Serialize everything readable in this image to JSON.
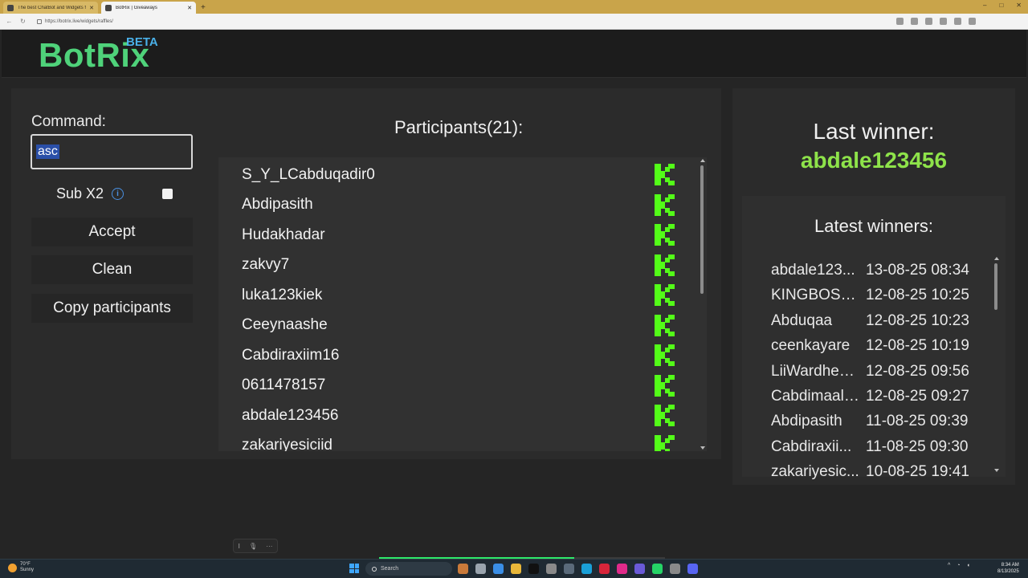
{
  "browser": {
    "tabs": [
      {
        "title": "The best ChatBot and Widgets fo",
        "active": false
      },
      {
        "title": "BotRix | Giveaways",
        "active": true
      }
    ],
    "url": "https://botrix.live/widgets/raffles/"
  },
  "app": {
    "logo": "BotRix",
    "badge": "BETA",
    "accent": "#4fd27a",
    "badge_color": "#4ab0e8"
  },
  "controls": {
    "command_label": "Command:",
    "command_value": "asc",
    "sub_label": "Sub X2",
    "sub_checked": false,
    "accept_label": "Accept",
    "clean_label": "Clean",
    "copy_label": "Copy participants"
  },
  "participants": {
    "title": "Participants(21):",
    "items": [
      "S_Y_LCabduqadir0",
      "Abdipasith",
      "Hudakhadar",
      "zakvy7",
      "luka123kiek",
      "Ceeynaashe",
      "Cabdiraxiim16",
      "0611478157",
      "abdale123456",
      "zakariyesiciid"
    ],
    "platform_icon": "kick-icon",
    "platform_color": "#53fc18"
  },
  "winner": {
    "last_label": "Last winner:",
    "last_name": "abdale123456",
    "latest_label": "Latest winners:",
    "latest": [
      {
        "name": "abdale123...",
        "date": "13-08-25 08:34"
      },
      {
        "name": "KINGBOSS...",
        "date": "12-08-25 10:25"
      },
      {
        "name": "Abduqaa",
        "date": "12-08-25 10:23"
      },
      {
        "name": "ceenkayare",
        "date": "12-08-25 10:19"
      },
      {
        "name": "LiiWardhee...",
        "date": "12-08-25 09:56"
      },
      {
        "name": "Cabdimaali...",
        "date": "12-08-25 09:27"
      },
      {
        "name": "Abdipasith",
        "date": "11-08-25 09:39"
      },
      {
        "name": "Cabdiraxii...",
        "date": "11-08-25 09:30"
      },
      {
        "name": "zakariyesic...",
        "date": "10-08-25 19:41"
      }
    ],
    "winner_color": "#8ee34a"
  },
  "taskbar": {
    "weather_temp": "70°F",
    "weather_desc": "Sunny",
    "search_label": "Search",
    "time": "8:34 AM",
    "date": "8/13/2025"
  }
}
